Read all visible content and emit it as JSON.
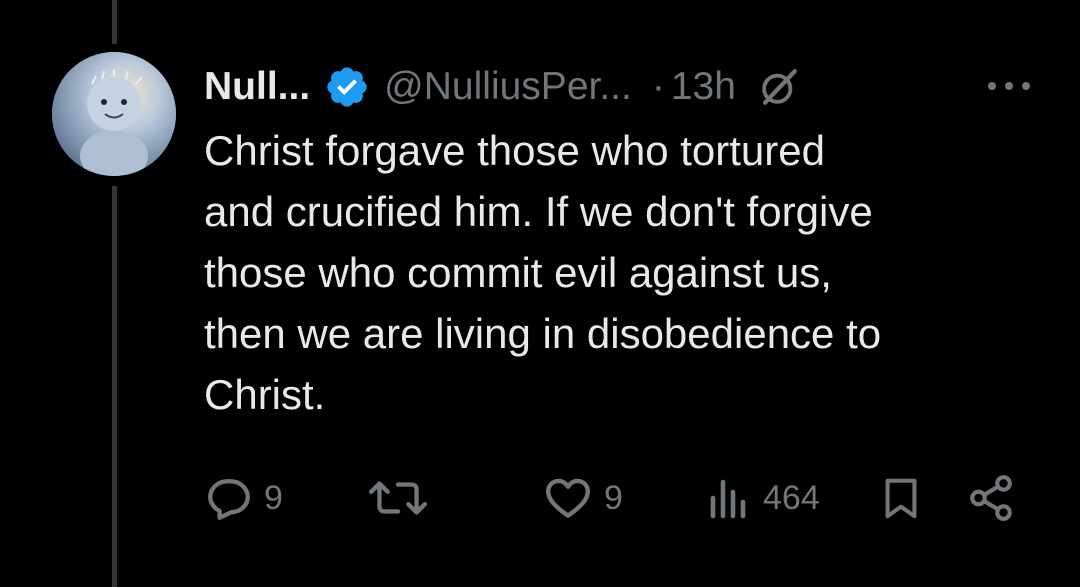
{
  "tweet": {
    "display_name": "Null...",
    "handle": "@NulliusPer...",
    "separator": "·",
    "time": "13h",
    "text": "Christ forgave those who tortured\nand crucified him. If we don't forgive\nthose who commit evil against us,\nthen we are living in disobedience to\nChrist."
  },
  "actions": {
    "reply_count": "9",
    "like_count": "9",
    "views_count": "464"
  },
  "icons": {
    "verified": "verified-badge-icon",
    "grok": "grok-icon",
    "more": "more-horizontal-icon",
    "reply": "reply-icon",
    "repost": "repost-icon",
    "like": "heart-icon",
    "views": "views-icon",
    "bookmark": "bookmark-icon",
    "share": "share-icon"
  },
  "colors": {
    "background": "#000000",
    "text": "#e7e9ea",
    "muted": "#71767b",
    "verified": "#1d9bf0",
    "thread_line": "#333639"
  }
}
